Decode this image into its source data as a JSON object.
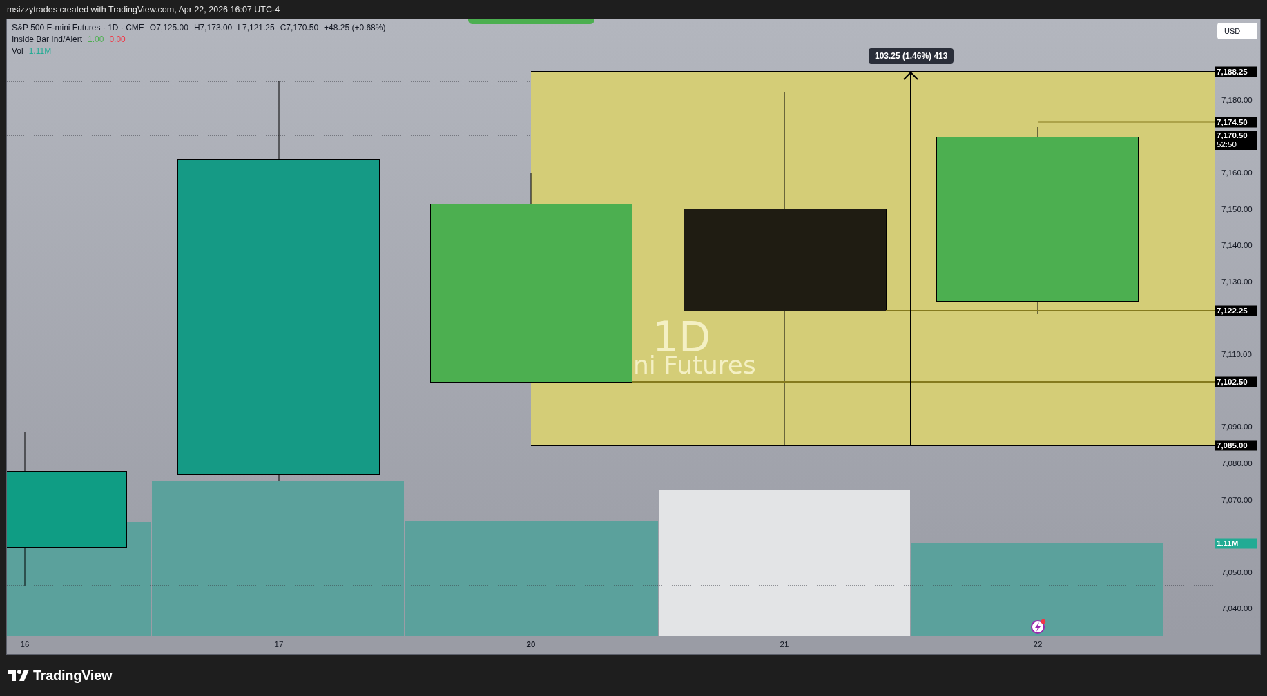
{
  "header": {
    "attribution": "msizzytrades created with TradingView.com, Apr 22, 2026 16:07 UTC-4"
  },
  "legend": {
    "symbol": "S&P 500 E-mini Futures · 1D · CME",
    "ohlc": [
      "O7,125.00",
      "H7,173.00",
      "L7,121.25",
      "C7,170.50"
    ],
    "change": "+48.25 (+0.68%)",
    "indicators": [
      {
        "name": "Inside Bar Ind/Alert",
        "values": [
          {
            "text": "1.00",
            "color": "#4caf50"
          },
          {
            "text": "0.00",
            "color": "#f23645"
          }
        ]
      },
      {
        "name": "Vol",
        "values": [
          {
            "text": "1.11M",
            "color": "#22ab94"
          }
        ]
      }
    ]
  },
  "watermark": {
    "interval": "1D",
    "symbol": "ni Futures"
  },
  "measure_tooltip": "103.25 (1.46%) 413",
  "currency_button": "USD",
  "price_axis": {
    "labels": [
      "7,180.00",
      "7,160.00",
      "7,150.00",
      "7,140.00",
      "7,130.00",
      "7,110.00",
      "7,090.00",
      "7,080.00",
      "7,070.00",
      "7,050.00",
      "7,040.00"
    ],
    "tags": [
      {
        "text": "7,188.25"
      },
      {
        "text": "7,174.50"
      },
      {
        "text": "7,170.50",
        "countdown": "52:50"
      },
      {
        "text": "7,122.25"
      },
      {
        "text": "7,102.50"
      },
      {
        "text": "7,085.00"
      }
    ],
    "volume_tag": "1.11M"
  },
  "time_axis": [
    {
      "label": "16",
      "bold": false
    },
    {
      "label": "17",
      "bold": false
    },
    {
      "label": "20",
      "bold": true
    },
    {
      "label": "21",
      "bold": false
    },
    {
      "label": "22",
      "bold": false
    }
  ],
  "footer": {
    "logo": "TradingView"
  }
}
